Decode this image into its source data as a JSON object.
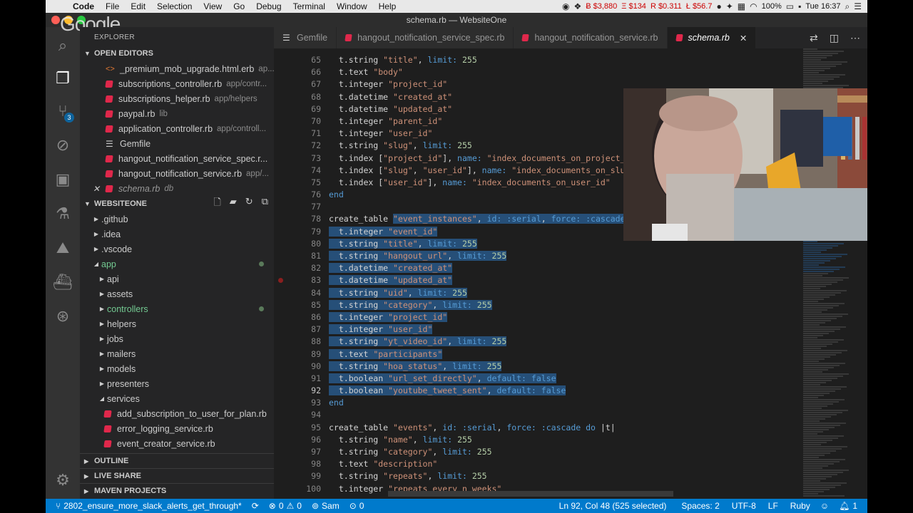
{
  "menubar": {
    "app_name": "Code",
    "items": [
      "File",
      "Edit",
      "Selection",
      "View",
      "Go",
      "Debug",
      "Terminal",
      "Window",
      "Help"
    ],
    "tickers": [
      "Ƀ $3,880",
      "Ξ $134",
      "R $0.311",
      "Ł $56.7"
    ],
    "battery": "100%",
    "clock": "Tue 16:37"
  },
  "window": {
    "title": "schema.rb — WebsiteOne"
  },
  "overlay": {
    "google_logo": "Google"
  },
  "activity": {
    "scm_badge": "3"
  },
  "sidebar": {
    "title": "EXPLORER",
    "open_editors": {
      "label": "OPEN EDITORS",
      "files": [
        {
          "name": "_premium_mob_upgrade.html.erb",
          "path": "ap...",
          "icon": "html"
        },
        {
          "name": "subscriptions_controller.rb",
          "path": "app/contr...",
          "icon": "ruby"
        },
        {
          "name": "subscriptions_helper.rb",
          "path": "app/helpers",
          "icon": "ruby"
        },
        {
          "name": "paypal.rb",
          "path": "lib",
          "icon": "ruby"
        },
        {
          "name": "application_controller.rb",
          "path": "app/controll...",
          "icon": "ruby"
        },
        {
          "name": "Gemfile",
          "path": "",
          "icon": "lines"
        },
        {
          "name": "hangout_notification_service_spec.r...",
          "path": "",
          "icon": "ruby"
        },
        {
          "name": "hangout_notification_service.rb",
          "path": "app/...",
          "icon": "ruby"
        },
        {
          "name": "schema.rb",
          "path": "db",
          "icon": "ruby",
          "active": true
        }
      ]
    },
    "workspace": {
      "label": "WEBSITEONE",
      "tree": [
        {
          "name": ".github",
          "depth": 0,
          "state": "closed"
        },
        {
          "name": ".idea",
          "depth": 0,
          "state": "closed"
        },
        {
          "name": ".vscode",
          "depth": 0,
          "state": "closed"
        },
        {
          "name": "app",
          "depth": 0,
          "state": "open",
          "modified": true
        },
        {
          "name": "api",
          "depth": 1,
          "state": "closed"
        },
        {
          "name": "assets",
          "depth": 1,
          "state": "closed"
        },
        {
          "name": "controllers",
          "depth": 1,
          "state": "closed",
          "modified": true
        },
        {
          "name": "helpers",
          "depth": 1,
          "state": "closed"
        },
        {
          "name": "jobs",
          "depth": 1,
          "state": "closed"
        },
        {
          "name": "mailers",
          "depth": 1,
          "state": "closed"
        },
        {
          "name": "models",
          "depth": 1,
          "state": "closed"
        },
        {
          "name": "presenters",
          "depth": 1,
          "state": "closed"
        },
        {
          "name": "services",
          "depth": 1,
          "state": "open"
        },
        {
          "name": "add_subscription_to_user_for_plan.rb",
          "depth": 2,
          "state": "file"
        },
        {
          "name": "error_logging_service.rb",
          "depth": 2,
          "state": "file"
        },
        {
          "name": "event_creator_service.rb",
          "depth": 2,
          "state": "file"
        }
      ]
    },
    "outline_label": "OUTLINE",
    "live_share_label": "LIVE SHARE",
    "maven_label": "MAVEN PROJECTS"
  },
  "tabs": [
    {
      "label": "Gemfile",
      "icon": "lines"
    },
    {
      "label": "hangout_notification_service_spec.rb",
      "icon": "ruby"
    },
    {
      "label": "hangout_notification_service.rb",
      "icon": "ruby"
    },
    {
      "label": "schema.rb",
      "icon": "ruby",
      "active": true
    }
  ],
  "editor": {
    "line_numbers": [
      65,
      66,
      67,
      68,
      69,
      70,
      71,
      72,
      73,
      74,
      75,
      76,
      77,
      78,
      79,
      80,
      81,
      82,
      83,
      84,
      85,
      86,
      87,
      88,
      89,
      90,
      91,
      92,
      93,
      94,
      95,
      96,
      97,
      98,
      99,
      100
    ],
    "current_line": 92,
    "breakpoint_line": 83,
    "lines": [
      "  t.string \"title\", limit: 255",
      "  t.text \"body\"",
      "  t.integer \"project_id\"",
      "  t.datetime \"created_at\"",
      "  t.datetime \"updated_at\"",
      "  t.integer \"parent_id\"",
      "  t.integer \"user_id\"",
      "  t.string \"slug\", limit: 255",
      "  t.index [\"project_id\"], name: \"index_documents_on_project_id\"",
      "  t.index [\"slug\", \"user_id\"], name: \"index_documents_on_slug_and_user_id\"",
      "  t.index [\"user_id\"], name: \"index_documents_on_user_id\"",
      "end",
      "",
      "create_table \"event_instances\", id: :serial, force: :cascade do |t|",
      "  t.integer \"event_id\"",
      "  t.string \"title\", limit: 255",
      "  t.string \"hangout_url\", limit: 255",
      "  t.datetime \"created_at\"",
      "  t.datetime \"updated_at\"",
      "  t.string \"uid\", limit: 255",
      "  t.string \"category\", limit: 255",
      "  t.integer \"project_id\"",
      "  t.integer \"user_id\"",
      "  t.string \"yt_video_id\", limit: 255",
      "  t.text \"participants\"",
      "  t.string \"hoa_status\", limit: 255",
      "  t.boolean \"url_set_directly\", default: false",
      "  t.boolean \"youtube_tweet_sent\", default: false",
      "end",
      "",
      "create_table \"events\", id: :serial, force: :cascade do |t|",
      "  t.string \"name\", limit: 255",
      "  t.string \"category\", limit: 255",
      "  t.text \"description\"",
      "  t.string \"repeats\", limit: 255",
      "  t.integer \"repeats_every_n_weeks\""
    ]
  },
  "statusbar": {
    "branch": "2802_ensure_more_slack_alerts_get_through*",
    "errors": "0",
    "warnings": "0",
    "live_user": "Sam",
    "ports": "0",
    "cursor": "Ln 92, Col 48 (525 selected)",
    "spaces": "Spaces: 2",
    "encoding": "UTF-8",
    "eol": "LF",
    "language": "Ruby",
    "notifications": "1"
  },
  "colors": {
    "statusbar": "#007acc",
    "selection": "#264f78",
    "ruby_icon": "#e0284b",
    "modified_green": "#73c991"
  }
}
